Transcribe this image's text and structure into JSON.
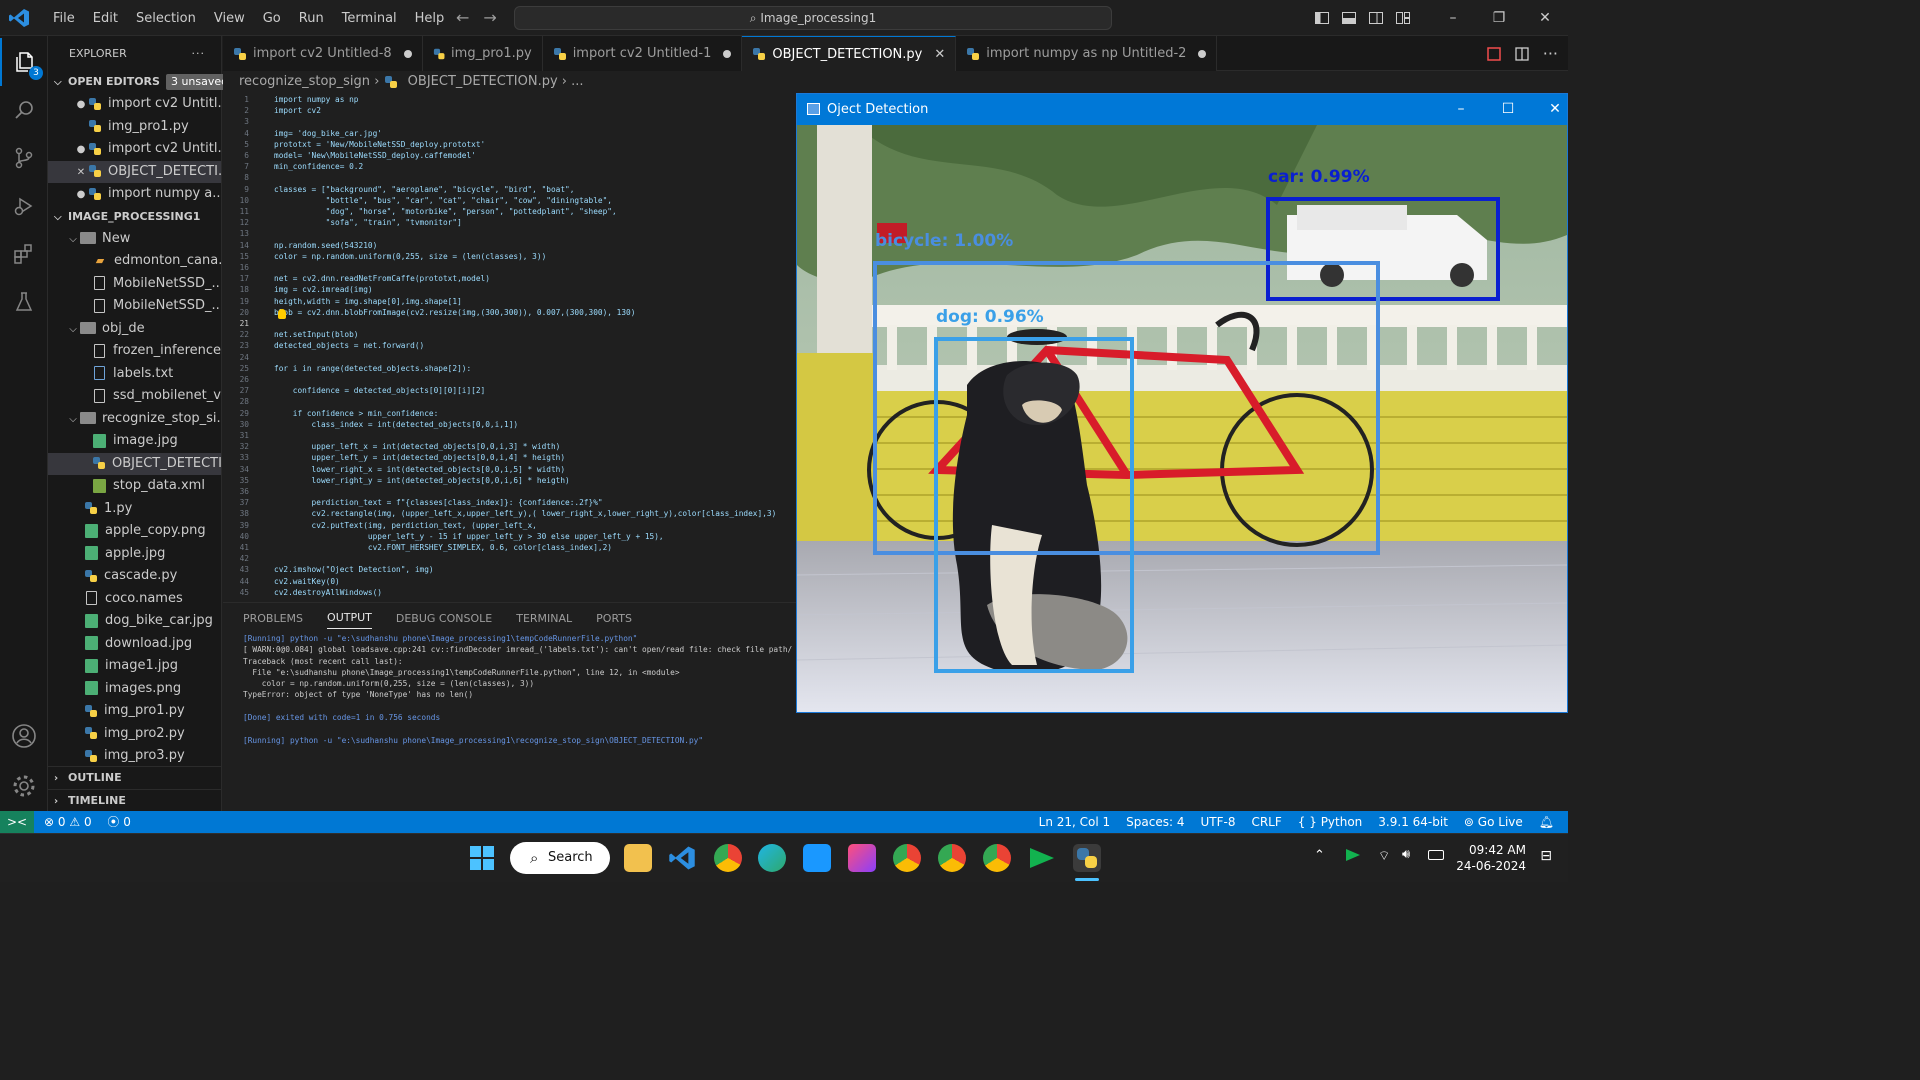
{
  "window": {
    "title": "Image_processing1"
  },
  "menu": [
    "File",
    "Edit",
    "Selection",
    "View",
    "Go",
    "Run",
    "Terminal",
    "Help"
  ],
  "activity_badge": "3",
  "sidebar": {
    "title": "EXPLORER",
    "more": "···",
    "open_editors_label": "OPEN EDITORS",
    "unsaved_badge": "3 unsaved",
    "open_editors": [
      "import cv2  Untitl...",
      "img_pro1.py",
      "import cv2  Untitl...",
      "OBJECT_DETECTI...",
      "import numpy a..."
    ],
    "project_label": "IMAGE_PROCESSING1",
    "tree": [
      "New",
      "edmonton_cana...",
      "MobileNetSSD_...",
      "MobileNetSSD_...",
      "obj_de",
      "frozen_inference...",
      "labels.txt",
      "ssd_mobilenet_v...",
      "recognize_stop_si...",
      "image.jpg",
      "OBJECT_DETECTI...",
      "stop_data.xml",
      "1.py",
      "apple_copy.png",
      "apple.jpg",
      "cascade.py",
      "coco.names",
      "dog_bike_car.jpg",
      "download.jpg",
      "image1.jpg",
      "images.png",
      "img_pro1.py",
      "img_pro2.py",
      "img_pro3.py"
    ],
    "outline_label": "OUTLINE",
    "timeline_label": "TIMELINE"
  },
  "tabs": [
    {
      "label": "import cv2  Untitled-8",
      "state": "dirty"
    },
    {
      "label": "img_pro1.py",
      "state": "clean"
    },
    {
      "label": "import cv2  Untitled-1",
      "state": "dirty"
    },
    {
      "label": "OBJECT_DETECTION.py",
      "state": "active"
    },
    {
      "label": "import numpy as np  Untitled-2",
      "state": "dirty"
    }
  ],
  "breadcrumb": {
    "folder": "recognize_stop_sign",
    "file": "OBJECT_DETECTION.py",
    "more": "..."
  },
  "code": {
    "numbers": [
      "1",
      "2",
      "3",
      "4",
      "5",
      "6",
      "7",
      "8",
      "9",
      "10",
      "11",
      "12",
      "13",
      "14",
      "15",
      "16",
      "17",
      "18",
      "19",
      "20",
      "21",
      "22",
      "23",
      "24",
      "25",
      "26",
      "27",
      "28",
      "29",
      "30",
      "31",
      "32",
      "33",
      "34",
      "35",
      "36",
      "37",
      "38",
      "39",
      "40",
      "41",
      "42",
      "43",
      "44",
      "45"
    ],
    "lines": [
      "import numpy as np",
      "import cv2",
      "",
      "img= 'dog_bike_car.jpg'",
      "prototxt = 'New/MobileNetSSD_deploy.prototxt'",
      "model= 'New\\MobileNetSSD_deploy.caffemodel'",
      "min_confidence= 0.2",
      "",
      "classes = [\"background\", \"aeroplane\", \"bicycle\", \"bird\", \"boat\",",
      "           \"bottle\", \"bus\", \"car\", \"cat\", \"chair\", \"cow\", \"diningtable\",",
      "           \"dog\", \"horse\", \"motorbike\", \"person\", \"pottedplant\", \"sheep\",",
      "           \"sofa\", \"train\", \"tvmonitor\"]",
      "",
      "np.random.seed(543210)",
      "color = np.random.uniform(0,255, size = (len(classes), 3))",
      "",
      "net = cv2.dnn.readNetFromCaffe(prototxt,model)",
      "img = cv2.imread(img)",
      "heigth,width = img.shape[0],img.shape[1]",
      "blob = cv2.dnn.blobFromImage(cv2.resize(img,(300,300)), 0.007,(300,300), 130)",
      "",
      "net.setInput(blob)",
      "detected_objects = net.forward()",
      "",
      "for i in range(detected_objects.shape[2]):",
      "",
      "    confidence = detected_objects[0][0][i][2]",
      "",
      "    if confidence > min_confidence:",
      "        class_index = int(detected_objects[0,0,i,1])",
      "",
      "        upper_left_x = int(detected_objects[0,0,i,3] * width)",
      "        upper_left_y = int(detected_objects[0,0,i,4] * heigth)",
      "        lower_right_x = int(detected_objects[0,0,i,5] * width)",
      "        lower_right_y = int(detected_objects[0,0,i,6] * heigth)",
      "",
      "        perdiction_text = f\"{classes[class_index]}: {confidence:.2f}%\"",
      "        cv2.rectangle(img, (upper_left_x,upper_left_y),( lower_right_x,lower_right_y),color[class_index],3)",
      "        cv2.putText(img, perdiction_text, (upper_left_x,",
      "                    upper_left_y - 15 if upper_left_y > 30 else upper_left_y + 15),",
      "                    cv2.FONT_HERSHEY_SIMPLEX, 0.6, color[class_index],2)",
      "",
      "cv2.imshow(\"Oject Detection\", img)",
      "cv2.waitKey(0)",
      "cv2.destroyAllWindows()"
    ]
  },
  "panel": {
    "tabs": [
      "PROBLEMS",
      "OUTPUT",
      "DEBUG CONSOLE",
      "TERMINAL",
      "PORTS"
    ],
    "active_tab": "OUTPUT",
    "output": [
      "[Running] python -u \"e:\\sudhanshu phone\\Image_processing1\\tempCodeRunnerFile.python\"",
      "[ WARN:0@0.084] global loadsave.cpp:241 cv::findDecoder imread_('labels.txt'): can't open/read file: check file path/",
      "Traceback (most recent call last):",
      "  File \"e:\\sudhanshu phone\\Image_processing1\\tempCodeRunnerFile.python\", line 12, in <module>",
      "    color = np.random.uniform(0,255, size = (len(classes), 3))",
      "TypeError: object of type 'NoneType' has no len()",
      "",
      "[Done] exited with code=1 in 0.756 seconds",
      "",
      "[Running] python -u \"e:\\sudhanshu phone\\Image_processing1\\recognize_stop_sign\\OBJECT_DETECTION.py\""
    ]
  },
  "cv_window": {
    "title": "Oject Detection",
    "detections": [
      {
        "label": "car: 0.99%",
        "color": "#0a1fd0"
      },
      {
        "label": "bicycle: 1.00%",
        "color": "#4a8ee0"
      },
      {
        "label": "dog: 0.96%",
        "color": "#3aa0e8"
      }
    ]
  },
  "statusbar": {
    "errors": "0",
    "warnings": "0",
    "ports": "0",
    "position": "Ln 21, Col 1",
    "spaces": "Spaces: 4",
    "encoding": "UTF-8",
    "eol": "CRLF",
    "language": "Python",
    "interpreter": "3.9.1 64-bit",
    "golive": "Go Live"
  },
  "taskbar": {
    "search": "Search",
    "time": "09:42 AM",
    "date": "24-06-2024"
  }
}
